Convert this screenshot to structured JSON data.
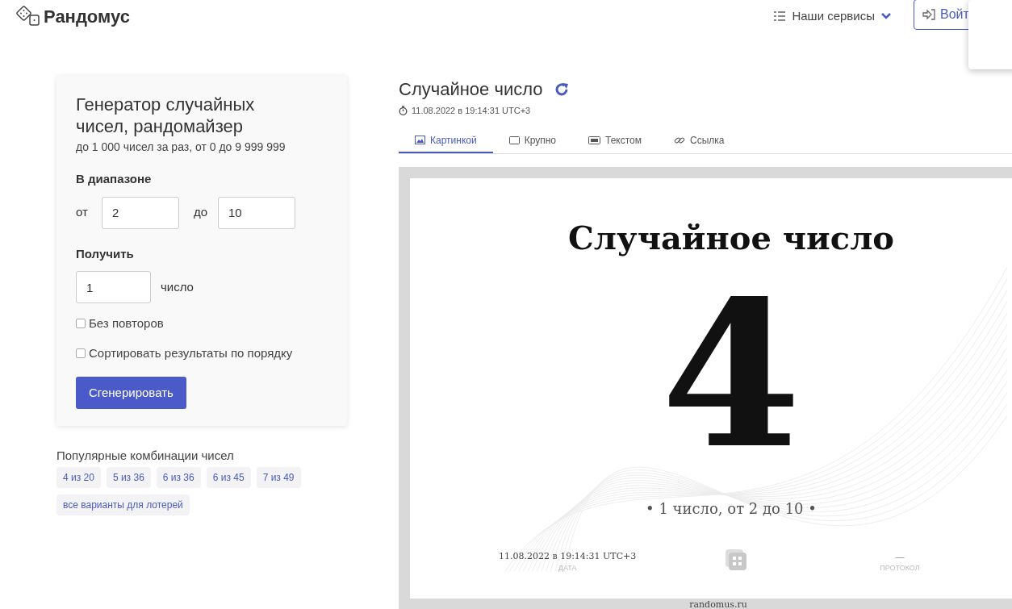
{
  "header": {
    "logo": "Рандомус",
    "services_menu": {
      "label": "Наши сервисы",
      "expanded": false
    },
    "login_button": "Войт"
  },
  "generator": {
    "title": "Генератор случайных чисел, рандомайзер",
    "subtitle": "до 1 000 чисел за раз, от 0 до 9 999 999",
    "range_label": "В диапазоне",
    "from_label": "от",
    "from_value": "2",
    "to_label": "до",
    "to_value": "10",
    "count_label": "Получить",
    "count_value": "1",
    "count_unit": "число",
    "options": [
      {
        "label": "Без повторов",
        "checked": false
      },
      {
        "label": "Сортировать результаты по порядку",
        "checked": false
      }
    ],
    "submit": "Сгенерировать"
  },
  "popular": {
    "title": "Популярные комбинации чисел",
    "chips": [
      "4 из 20",
      "5 из 36",
      "6 из 36",
      "6 из 45",
      "7 из 49",
      "все варианты для лотерей"
    ]
  },
  "result": {
    "title": "Случайное число",
    "timestamp": "11.08.2022 в 19:14:31 UTC+3",
    "tabs": [
      {
        "label": "Картинкой",
        "selected": true
      },
      {
        "label": "Крупно",
        "selected": false
      },
      {
        "label": "Текстом",
        "selected": false
      },
      {
        "label": "Ссылка",
        "selected": false
      }
    ],
    "image": {
      "title": "Случайное число",
      "number": "4",
      "caption": "• 1 число, от 2 до 10 •",
      "date": "11.08.2022 в 19:14:31 UTC+3",
      "date_label": "ДАТА",
      "protocol": "—",
      "protocol_label": "ПРОТОКОЛ",
      "site": "randomus.ru"
    }
  }
}
